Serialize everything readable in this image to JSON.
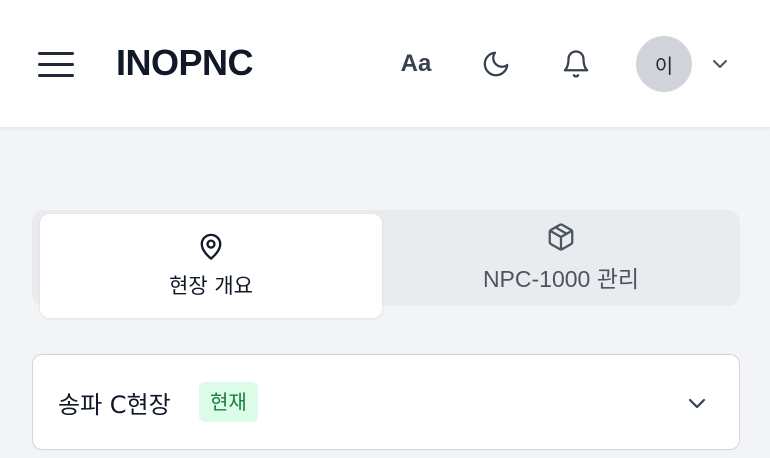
{
  "header": {
    "logo": "INOPNC",
    "font_button_label": "Aa",
    "avatar_initial": "이",
    "icons": {
      "menu": "hamburger-menu-icon",
      "font": "font-size-icon",
      "theme": "moon-icon",
      "notifications": "bell-icon",
      "account_menu": "chevron-down-icon"
    }
  },
  "tabs": [
    {
      "label": "현장 개요",
      "icon": "map-pin-icon",
      "active": true
    },
    {
      "label": "NPC-1000 관리",
      "icon": "package-icon",
      "active": false
    }
  ],
  "site_selector": {
    "name": "송파 C현장",
    "badge": "현재",
    "icon": "chevron-down-icon"
  },
  "colors": {
    "page_bg": "#f3f4f6",
    "header_bg": "#ffffff",
    "tab_bar_bg": "#e9ebef",
    "badge_bg": "#dcfce7",
    "badge_text": "#15803d",
    "avatar_bg": "#d1d5db"
  }
}
